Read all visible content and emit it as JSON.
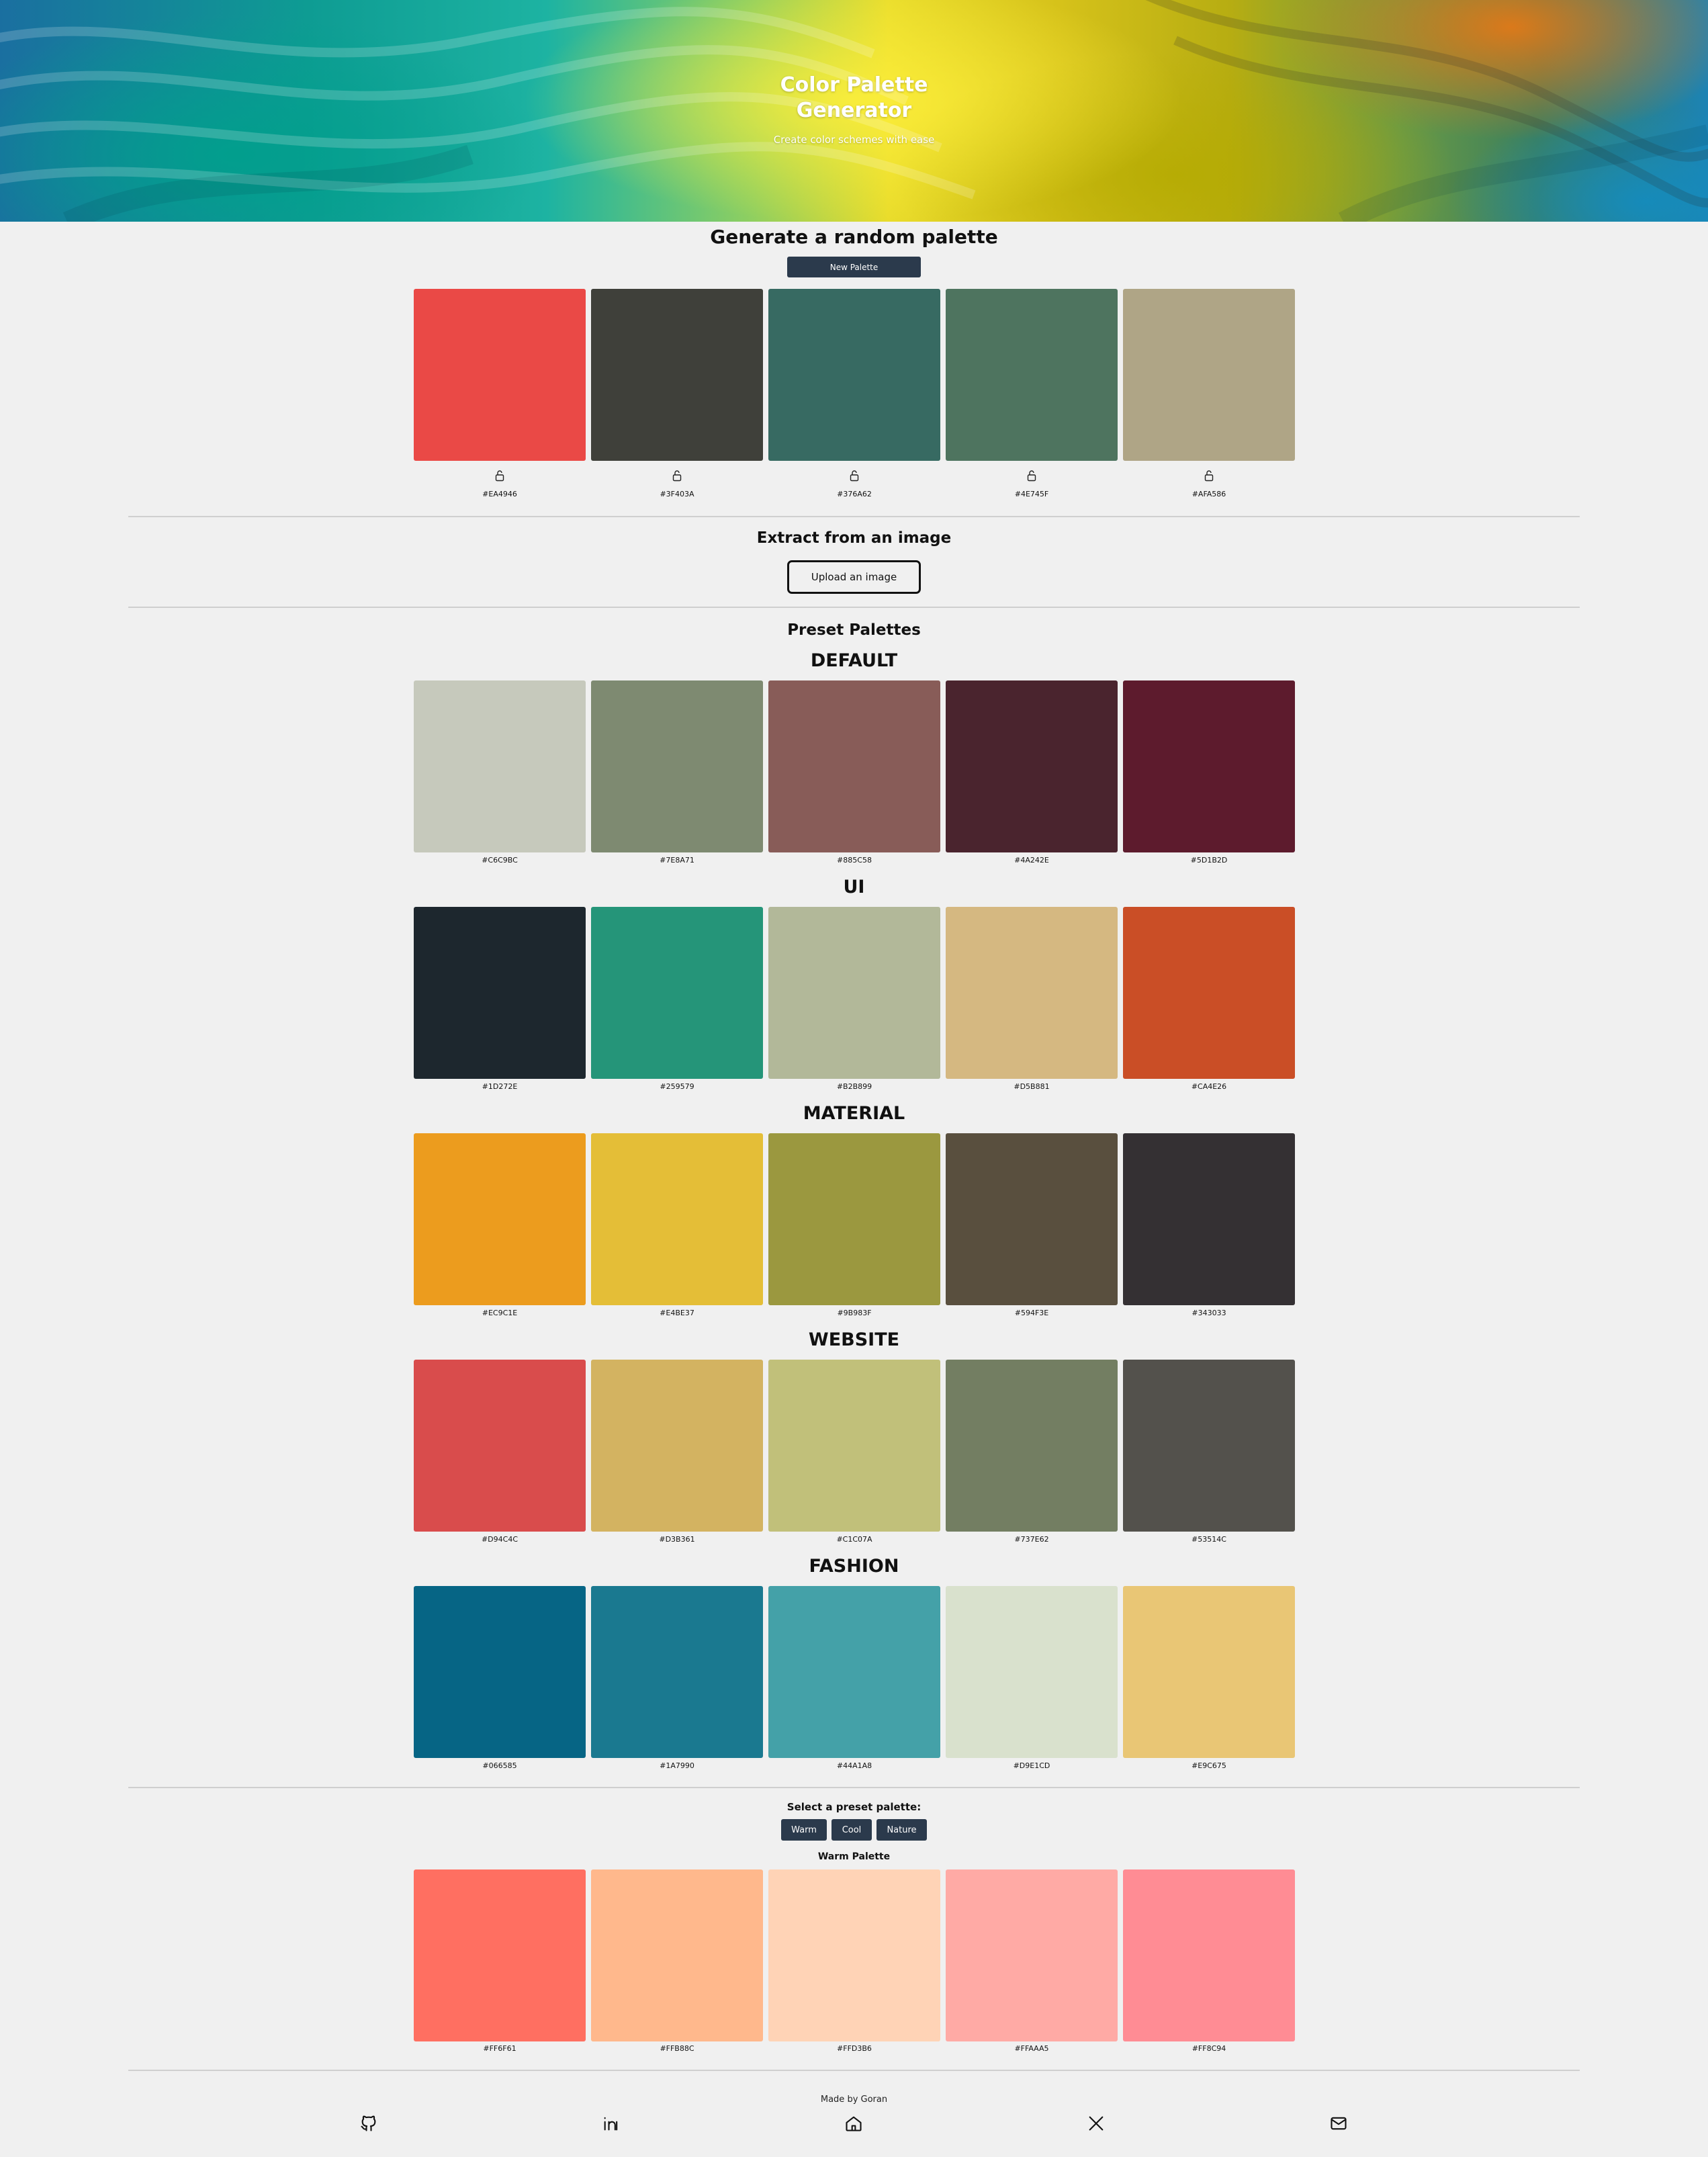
{
  "hero": {
    "title_line1": "Color Palette",
    "title_line2": "Generator",
    "subtitle": "Create color schemes with ease"
  },
  "random": {
    "heading": "Generate a random palette",
    "button_label": "New Palette",
    "colors": [
      "#EA4946",
      "#3F403A",
      "#376A62",
      "#4E745F",
      "#AFA586"
    ]
  },
  "extract": {
    "heading": "Extract from an image",
    "button_label": "Upload an image"
  },
  "presets": {
    "heading": "Preset Palettes",
    "palettes": [
      {
        "name": "DEFAULT",
        "colors": [
          "#C6C9BC",
          "#7E8A71",
          "#885C58",
          "#4A242E",
          "#5D1B2D"
        ]
      },
      {
        "name": "UI",
        "colors": [
          "#1D272E",
          "#259579",
          "#B2B899",
          "#D5B881",
          "#CA4E26"
        ]
      },
      {
        "name": "MATERIAL",
        "colors": [
          "#EC9C1E",
          "#E4BE37",
          "#9B983F",
          "#594F3E",
          "#343033"
        ]
      },
      {
        "name": "WEBSITE",
        "colors": [
          "#D94C4C",
          "#D3B361",
          "#C1C07A",
          "#737E62",
          "#53514C"
        ]
      },
      {
        "name": "FASHION",
        "colors": [
          "#066585",
          "#1A7990",
          "#44A1A8",
          "#D9E1CD",
          "#E9C675"
        ]
      }
    ]
  },
  "select": {
    "label": "Select a preset palette:",
    "options": [
      "Warm",
      "Cool",
      "Nature"
    ],
    "active_title": "Warm Palette",
    "colors": [
      "#FF6F61",
      "#FFB88C",
      "#FFD3B6",
      "#FFAAA5",
      "#FF8C94"
    ]
  },
  "footer": {
    "made_by": "Made by Goran",
    "icons": [
      "github-icon",
      "linkedin-icon",
      "home-icon",
      "x-icon",
      "mail-icon"
    ]
  },
  "colors": {
    "background": "#f0f0f0",
    "button": "#2b3a4c",
    "divider": "#cfcfcf"
  }
}
